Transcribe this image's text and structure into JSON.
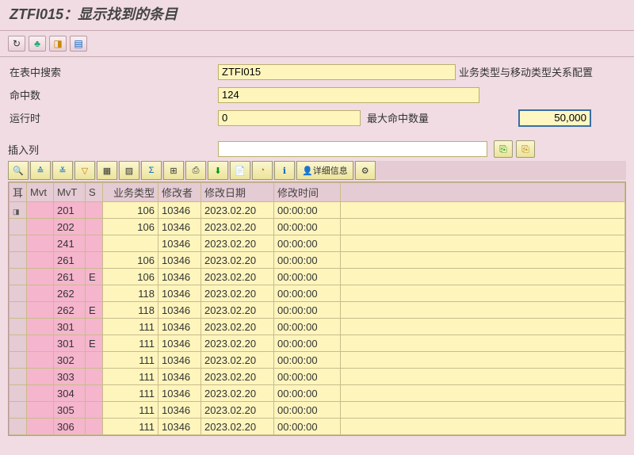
{
  "title": "ZTFI015：显示找到的条目",
  "toolbar_top": [
    "tbl-icon",
    "tree-icon",
    "layout-icon",
    "export-icon"
  ],
  "form": {
    "search_label": "在表中搜索",
    "search_value": "ZTFI015",
    "desc": "业务类型与移动类型关系配置",
    "hits_label": "命中数",
    "hits_value": "124",
    "runtime_label": "运行时",
    "runtime_value": "0",
    "max_label": "最大命中数量",
    "max_value": "50,000"
  },
  "insert": {
    "label": "插入列",
    "value": ""
  },
  "detail_label": "详细信息",
  "columns": {
    "sel": "⽿",
    "mvt1": "Mvt",
    "mvt2": "MvT",
    "s": "S",
    "btype": "业务类型",
    "user": "修改者",
    "date": "修改日期",
    "time": "修改时间"
  },
  "rows": [
    {
      "mvt": "",
      "mvt2": "201",
      "s": "",
      "btype": "106",
      "user": "10346",
      "date": "2023.02.20",
      "time": "00:00:00",
      "indicator": true
    },
    {
      "mvt": "",
      "mvt2": "202",
      "s": "",
      "btype": "106",
      "user": "10346",
      "date": "2023.02.20",
      "time": "00:00:00"
    },
    {
      "mvt": "",
      "mvt2": "241",
      "s": "",
      "btype": "",
      "user": "10346",
      "date": "2023.02.20",
      "time": "00:00:00"
    },
    {
      "mvt": "",
      "mvt2": "261",
      "s": "",
      "btype": "106",
      "user": "10346",
      "date": "2023.02.20",
      "time": "00:00:00"
    },
    {
      "mvt": "",
      "mvt2": "261",
      "s": "E",
      "btype": "106",
      "user": "10346",
      "date": "2023.02.20",
      "time": "00:00:00"
    },
    {
      "mvt": "",
      "mvt2": "262",
      "s": "",
      "btype": "118",
      "user": "10346",
      "date": "2023.02.20",
      "time": "00:00:00"
    },
    {
      "mvt": "",
      "mvt2": "262",
      "s": "E",
      "btype": "118",
      "user": "10346",
      "date": "2023.02.20",
      "time": "00:00:00"
    },
    {
      "mvt": "",
      "mvt2": "301",
      "s": "",
      "btype": "111",
      "user": "10346",
      "date": "2023.02.20",
      "time": "00:00:00"
    },
    {
      "mvt": "",
      "mvt2": "301",
      "s": "E",
      "btype": "111",
      "user": "10346",
      "date": "2023.02.20",
      "time": "00:00:00"
    },
    {
      "mvt": "",
      "mvt2": "302",
      "s": "",
      "btype": "111",
      "user": "10346",
      "date": "2023.02.20",
      "time": "00:00:00"
    },
    {
      "mvt": "",
      "mvt2": "303",
      "s": "",
      "btype": "111",
      "user": "10346",
      "date": "2023.02.20",
      "time": "00:00:00"
    },
    {
      "mvt": "",
      "mvt2": "304",
      "s": "",
      "btype": "111",
      "user": "10346",
      "date": "2023.02.20",
      "time": "00:00:00"
    },
    {
      "mvt": "",
      "mvt2": "305",
      "s": "",
      "btype": "111",
      "user": "10346",
      "date": "2023.02.20",
      "time": "00:00:00"
    },
    {
      "mvt": "",
      "mvt2": "306",
      "s": "",
      "btype": "111",
      "user": "10346",
      "date": "2023.02.20",
      "time": "00:00:00"
    }
  ]
}
